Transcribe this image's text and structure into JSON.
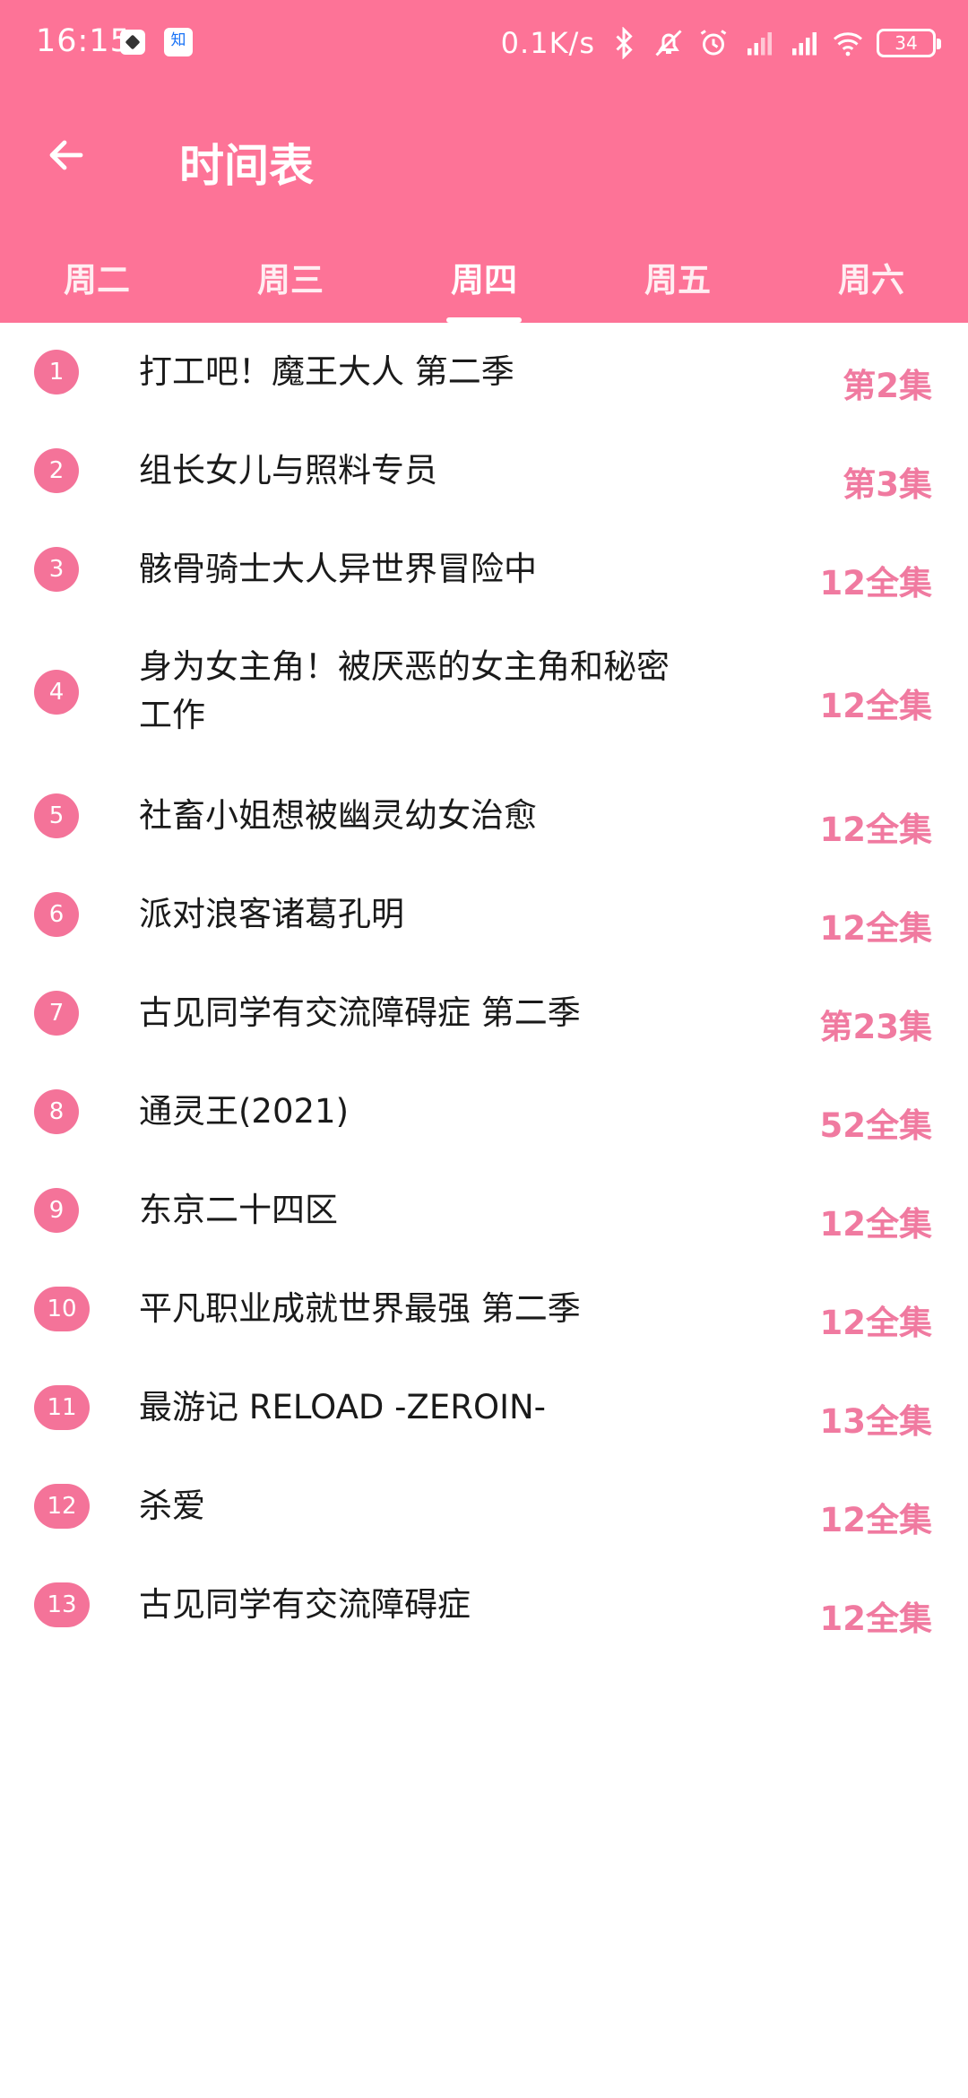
{
  "status": {
    "time": "16:15",
    "app_icon_2_text": "知",
    "net_speed": "0.1K/s",
    "battery": "34"
  },
  "header": {
    "title": "时间表",
    "back_icon": "back-arrow-icon",
    "color": "#fd7397"
  },
  "tabs": [
    {
      "label": "周二",
      "active": false
    },
    {
      "label": "周三",
      "active": false
    },
    {
      "label": "周四",
      "active": true
    },
    {
      "label": "周五",
      "active": false
    },
    {
      "label": "周六",
      "active": false
    }
  ],
  "list": [
    {
      "num": "1",
      "title": "打工吧！魔王大人 第二季",
      "ep": "第2集"
    },
    {
      "num": "2",
      "title": "组长女儿与照料专员",
      "ep": "第3集"
    },
    {
      "num": "3",
      "title": "骸骨骑士大人异世界冒险中",
      "ep": "12全集"
    },
    {
      "num": "4",
      "title": "身为女主角！被厌恶的女主角和秘密工作",
      "ep": "12全集"
    },
    {
      "num": "5",
      "title": "社畜小姐想被幽灵幼女治愈",
      "ep": "12全集"
    },
    {
      "num": "6",
      "title": "派对浪客诸葛孔明",
      "ep": "12全集"
    },
    {
      "num": "7",
      "title": "古见同学有交流障碍症 第二季",
      "ep": "第23集"
    },
    {
      "num": "8",
      "title": "通灵王(2021)",
      "ep": "52全集"
    },
    {
      "num": "9",
      "title": "东京二十四区",
      "ep": "12全集"
    },
    {
      "num": "10",
      "title": "平凡职业成就世界最强 第二季",
      "ep": "12全集"
    },
    {
      "num": "11",
      "title": "最游记 RELOAD -ZEROIN-",
      "ep": "13全集"
    },
    {
      "num": "12",
      "title": "杀爱",
      "ep": "12全集"
    },
    {
      "num": "13",
      "title": "古见同学有交流障碍症",
      "ep": "12全集"
    }
  ]
}
